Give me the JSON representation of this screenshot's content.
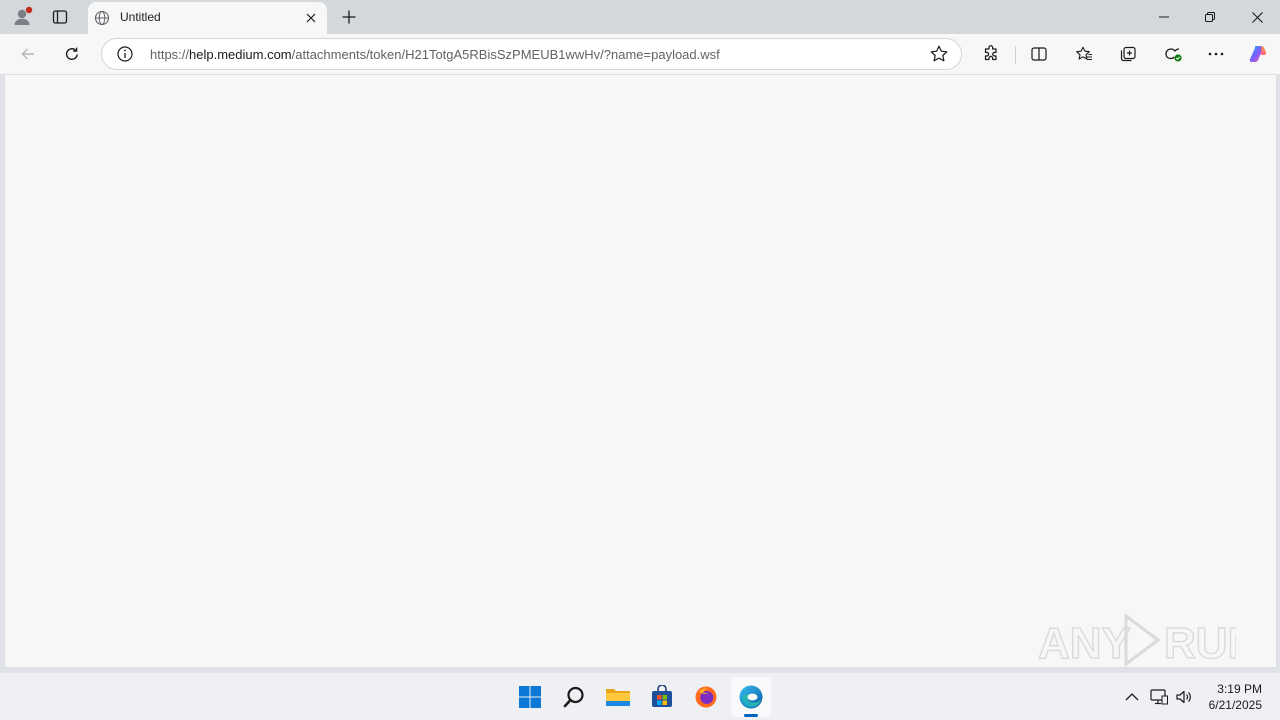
{
  "browser": {
    "tab": {
      "title": "Untitled"
    },
    "address_bar": {
      "scheme": "https://",
      "domain": "help.medium.com",
      "path": "/attachments/token/H21TotgA5RBisSzPMEUB1wwHv/?name=payload.wsf"
    },
    "toolbar_icons": [
      "back-icon",
      "refresh-icon",
      "site-info-icon",
      "favorite-star-icon",
      "extensions-icon",
      "split-screen-icon",
      "favorites-icon",
      "collections-icon",
      "browser-essentials-icon",
      "more-icon",
      "copilot-icon"
    ],
    "window_controls": [
      "minimize-icon",
      "restore-icon",
      "close-icon"
    ]
  },
  "watermark": {
    "text": "ANY RUN"
  },
  "taskbar": {
    "apps": [
      "start-icon",
      "search-icon",
      "file-explorer-icon",
      "store-icon",
      "firefox-icon",
      "edge-icon"
    ],
    "tray": [
      "show-hidden-icons-icon",
      "network-icon",
      "volume-icon"
    ],
    "clock": {
      "time": "3:19 PM",
      "date": "6/21/2025"
    }
  },
  "colors": {
    "accent": "#0067c0",
    "tabstrip": "#d3d8dd",
    "content_bg": "#f7f7f7"
  }
}
